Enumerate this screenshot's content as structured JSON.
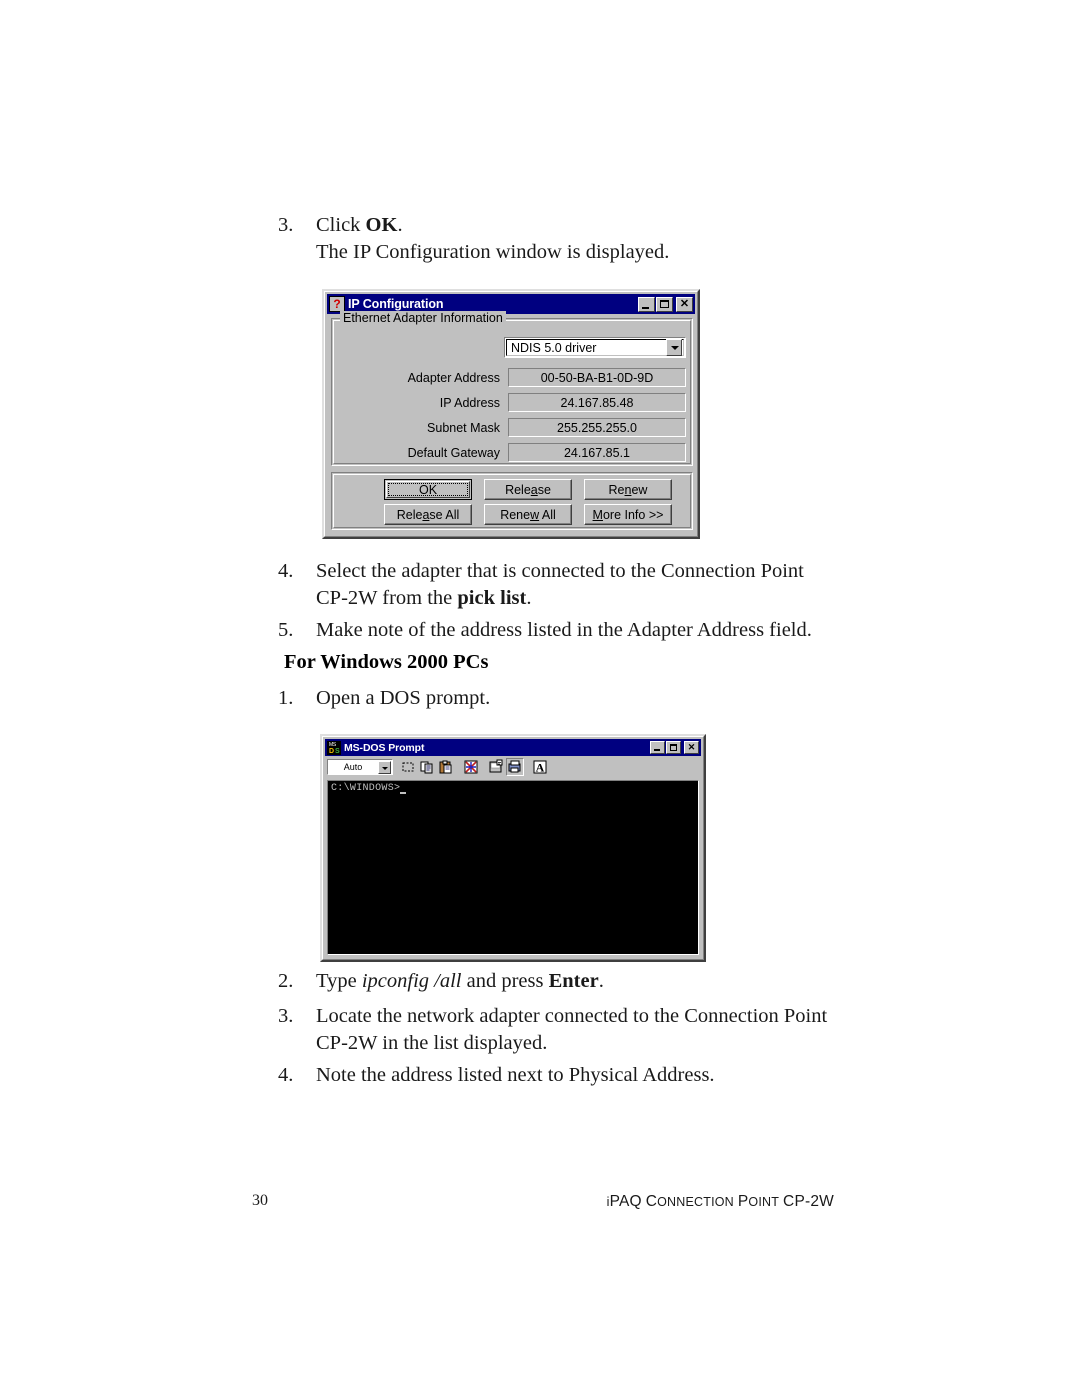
{
  "document": {
    "steps_top": [
      {
        "num": "3.",
        "line1_prefix": "Click ",
        "line1_bold": "OK",
        "line1_suffix": ".",
        "line2": "The IP Configuration window is displayed."
      }
    ],
    "steps_mid": [
      {
        "num": "4.",
        "line1": "Select the adapter that is connected to the Connection Point",
        "line2_prefix": "CP-2W from the ",
        "line2_bold": "pick list",
        "line2_suffix": "."
      },
      {
        "num": "5.",
        "line1": "Make note of the address listed in the Adapter Address field."
      }
    ],
    "heading": "For Windows 2000 PCs",
    "steps_win2000_first": {
      "num": "1.",
      "line1": "Open a DOS prompt."
    },
    "steps_bottom": [
      {
        "num": "2.",
        "prefix": "Type ",
        "italic": "ipconfig /all",
        "mid": " and press ",
        "bold": "Enter",
        "suffix": "."
      },
      {
        "num": "3.",
        "line1": "Locate the network adapter connected to the Connection Point",
        "line2": "CP-2W in the list displayed."
      },
      {
        "num": "4.",
        "line1": "Note the address listed next to Physical Address."
      }
    ],
    "footer": {
      "page_number": "30",
      "title_i": "i",
      "title_paq": "PAQ",
      "title_c": "C",
      "title_onnection": "ONNECTION",
      "title_p": "P",
      "title_oint": "OINT",
      "title_cp": "CP-2W"
    }
  },
  "ip_config_window": {
    "title": "IP Configuration",
    "title_icon": "question-mark-icon",
    "window_controls": {
      "minimize": "minimize-icon",
      "maximize": "maximize-icon",
      "close": "✕"
    },
    "groupbox_label": "Ethernet  Adapter Information",
    "adapter_select": {
      "value": "NDIS 5.0 driver"
    },
    "fields": [
      {
        "label": "Adapter Address",
        "value": "00-50-BA-B1-0D-9D"
      },
      {
        "label": "IP Address",
        "value": "24.167.85.48"
      },
      {
        "label": "Subnet Mask",
        "value": "255.255.255.0"
      },
      {
        "label": "Default Gateway",
        "value": "24.167.85.1"
      }
    ],
    "buttons": [
      {
        "label": "OK",
        "accel_before": "OK",
        "accel": "",
        "accel_after": "",
        "default": true
      },
      {
        "label": "Release",
        "accel_before": "Rele",
        "accel": "a",
        "accel_after": "se",
        "default": false
      },
      {
        "label": "Renew",
        "accel_before": "Re",
        "accel": "n",
        "accel_after": "ew",
        "default": false
      },
      {
        "label": "Release All",
        "accel_before": "Rele",
        "accel": "a",
        "accel_after": "se All",
        "default": false
      },
      {
        "label": "Renew All",
        "accel_before": "Rene",
        "accel": "w",
        "accel_after": " All",
        "default": false
      },
      {
        "label": "More Info >>",
        "accel_before": "",
        "accel": "M",
        "accel_after": "ore Info >>",
        "default": false
      }
    ],
    "colors": {
      "titlebar": "#000080",
      "face": "#c0c0c0",
      "shadow": "#808080",
      "highlight": "#ffffff"
    }
  },
  "msdos_window": {
    "title": "MS-DOS Prompt",
    "title_icon": "ms-dos-icon",
    "icon_ms": "MS",
    "icon_d": "D",
    "icon_s": "S",
    "window_controls": {
      "minimize": "minimize-icon",
      "maximize": "maximize-icon",
      "close": "✕"
    },
    "toolbar": {
      "font_size_value": "Auto",
      "buttons": [
        "mark-icon",
        "copy-icon",
        "paste-icon",
        "full-screen-icon",
        "properties-icon",
        "background-icon",
        "font-icon"
      ],
      "font_button_label": "A"
    },
    "console": {
      "prompt": "C:\\WINDOWS>"
    },
    "colors": {
      "titlebar": "#000080",
      "console_bg": "#000000",
      "console_fg": "#c0c0c0"
    }
  }
}
